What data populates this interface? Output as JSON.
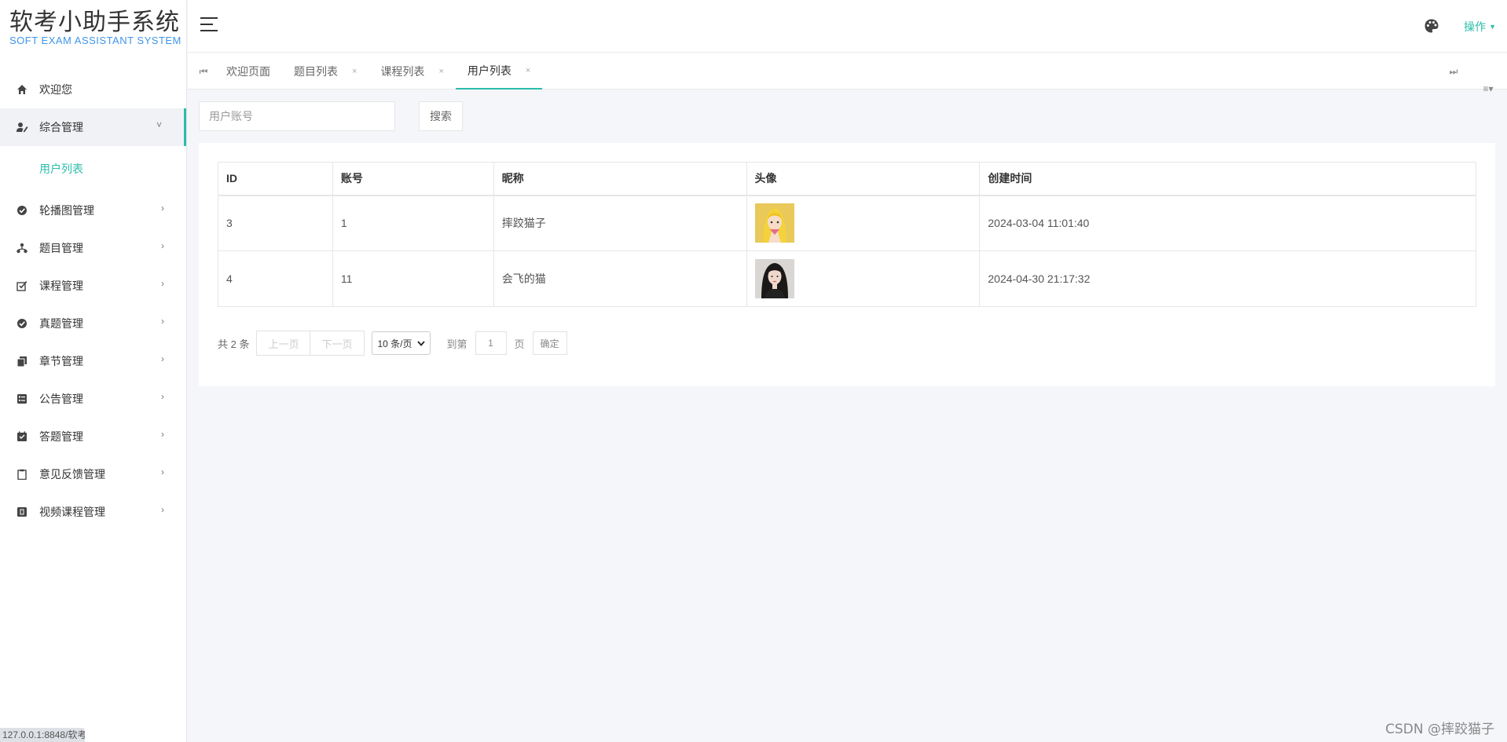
{
  "app": {
    "title": "软考小助手系统",
    "subtitle": "SOFT EXAM ASSISTANT SYSTEM"
  },
  "sidebar": {
    "items": [
      {
        "label": "欢迎您",
        "icon": "home-icon"
      },
      {
        "label": "综合管理",
        "icon": "user-edit-icon",
        "open": true,
        "submenu": [
          {
            "label": "用户列表"
          }
        ]
      },
      {
        "label": "轮播图管理",
        "icon": "check-circle-icon"
      },
      {
        "label": "题目管理",
        "icon": "sitemap-icon"
      },
      {
        "label": "课程管理",
        "icon": "checklist-icon"
      },
      {
        "label": "真题管理",
        "icon": "check-circle-icon"
      },
      {
        "label": "章节管理",
        "icon": "copy-icon"
      },
      {
        "label": "公告管理",
        "icon": "list-icon"
      },
      {
        "label": "答题管理",
        "icon": "notes-icon"
      },
      {
        "label": "意见反馈管理",
        "icon": "clipboard-icon"
      },
      {
        "label": "视频课程管理",
        "icon": "video-icon"
      }
    ]
  },
  "header": {
    "ops_label": "操作"
  },
  "tabs": [
    {
      "label": "欢迎页面",
      "closable": false
    },
    {
      "label": "题目列表",
      "closable": true
    },
    {
      "label": "课程列表",
      "closable": true
    },
    {
      "label": "用户列表",
      "closable": true,
      "active": true
    }
  ],
  "search": {
    "placeholder": "用户账号",
    "button_label": "搜索"
  },
  "table": {
    "columns": [
      "ID",
      "账号",
      "昵称",
      "头像",
      "创建时间"
    ],
    "rows": [
      {
        "id": "3",
        "account": "1",
        "nickname": "摔跤猫子",
        "avatar": "avatar-cartoon",
        "created": "2024-03-04 11:01:40"
      },
      {
        "id": "4",
        "account": "11",
        "nickname": "会飞的猫",
        "avatar": "avatar-photo",
        "created": "2024-04-30 21:17:32"
      }
    ]
  },
  "pager": {
    "total": "共 2 条",
    "prev": "上一页",
    "next": "下一页",
    "page_size": "10 条/页",
    "goto": "到第",
    "page_input": "1",
    "page_unit": "页",
    "confirm": "确定"
  },
  "status_url": "127.0.0.1:8848/软考",
  "watermark": "CSDN @摔跤猫子",
  "colors": {
    "accent": "#2bbcac",
    "logo_sub": "#3f95ea"
  }
}
